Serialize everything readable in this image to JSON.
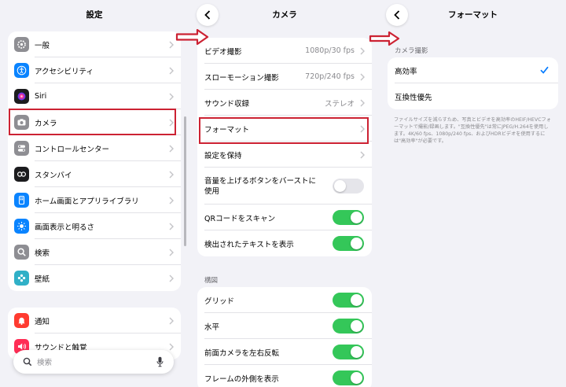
{
  "settings": {
    "title": "設定",
    "items": [
      {
        "label": "一般",
        "icon": "gear-icon",
        "color": "#8e8e93"
      },
      {
        "label": "アクセシビリティ",
        "icon": "accessibility-icon",
        "color": "#0a84ff"
      },
      {
        "label": "Siri",
        "icon": "siri-icon",
        "color": "#1c1c1e"
      },
      {
        "label": "カメラ",
        "icon": "camera-icon",
        "color": "#8e8e93"
      },
      {
        "label": "コントロールセンター",
        "icon": "control-center-icon",
        "color": "#8e8e93"
      },
      {
        "label": "スタンバイ",
        "icon": "standby-icon",
        "color": "#1c1c1e"
      },
      {
        "label": "ホーム画面とアプリライブラリ",
        "icon": "home-screen-icon",
        "color": "#0a84ff"
      },
      {
        "label": "画面表示と明るさ",
        "icon": "brightness-icon",
        "color": "#0a84ff"
      },
      {
        "label": "検索",
        "icon": "search-icon",
        "color": "#8e8e93"
      },
      {
        "label": "壁紙",
        "icon": "wallpaper-icon",
        "color": "#30b0c7"
      }
    ],
    "items2": [
      {
        "label": "通知",
        "icon": "notification-icon",
        "color": "#ff3b30"
      },
      {
        "label": "サウンドと触覚",
        "icon": "sound-icon",
        "color": "#ff2d55"
      }
    ],
    "search_placeholder": "検索"
  },
  "camera": {
    "title": "カメラ",
    "rows": [
      {
        "label": "ビデオ撮影",
        "value": "1080p/30 fps"
      },
      {
        "label": "スローモーション撮影",
        "value": "720p/240 fps"
      },
      {
        "label": "サウンド収録",
        "value": "ステレオ"
      },
      {
        "label": "フォーマット",
        "value": ""
      },
      {
        "label": "設定を保持",
        "value": ""
      },
      {
        "label": "音量を上げるボタンをバーストに使用",
        "toggle": false
      },
      {
        "label": "QRコードをスキャン",
        "toggle": true
      },
      {
        "label": "検出されたテキストを表示",
        "toggle": true
      }
    ],
    "section2_header": "構図",
    "rows2": [
      {
        "label": "グリッド",
        "toggle": true
      },
      {
        "label": "水平",
        "toggle": true
      },
      {
        "label": "前面カメラを左右反転",
        "toggle": true
      },
      {
        "label": "フレームの外側を表示",
        "toggle": true
      }
    ]
  },
  "format": {
    "title": "フォーマット",
    "section_header": "カメラ撮影",
    "options": [
      {
        "label": "高効率",
        "selected": true
      },
      {
        "label": "互換性優先",
        "selected": false
      }
    ],
    "footnote": "ファイルサイズを減らすため、写真とビデオを高効率のHEIF/HEVCフォーマットで撮影/録画します。\"互換性優先\"は常にJPEG/H.264を使用します。4K/60 fps、1080p/240 fps、およびHDRビデオを使用するには\"高効率\"が必要です。"
  },
  "colors": {
    "accent": "#007aff",
    "toggle_on": "#34c759",
    "highlight": "#cc2233"
  }
}
